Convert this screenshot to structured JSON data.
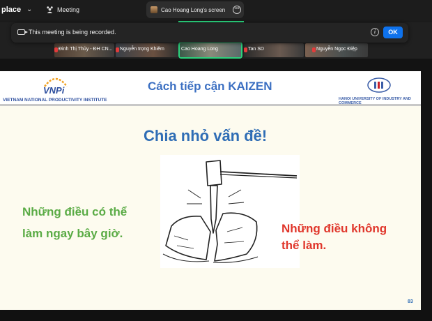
{
  "topbar": {
    "app_label": "place",
    "meeting_label": "Meeting",
    "screen_tab_label": "Cao Hoang Long's screen"
  },
  "participants": [
    {
      "name": "Đinh Thị Thủy - ĐH CN..."
    },
    {
      "name": "Nguyễn trọng Khiêm"
    },
    {
      "name": "Cao Hoang Long"
    },
    {
      "name": "Tan SD"
    },
    {
      "name": "Nguyễn Ngọc Điệp"
    }
  ],
  "recording_banner": {
    "text": "This meeting is being recorded.",
    "ok_label": "OK"
  },
  "slide": {
    "org_logo_text": "VNPi",
    "org_name": "VIETNAM NATIONAL PRODUCTIVITY INSTITUTE",
    "title": "Cách tiếp cận KAIZEN",
    "university": "HANOI UNIVERSITY OF INDUSTRY AND COMMERCE",
    "headline": "Chia nhỏ vấn đề!",
    "left_line1": "Những điều có thể",
    "left_line2": "làm ngay bây giờ.",
    "right_line1": "Những điều không",
    "right_line2": "thể làm.",
    "page_number": "83"
  },
  "colors": {
    "accent_green": "#2bd27c",
    "ok_blue": "#0e72ed",
    "slide_title_blue": "#3b6fc2",
    "left_green": "#5aab45",
    "right_red": "#e0362b"
  }
}
